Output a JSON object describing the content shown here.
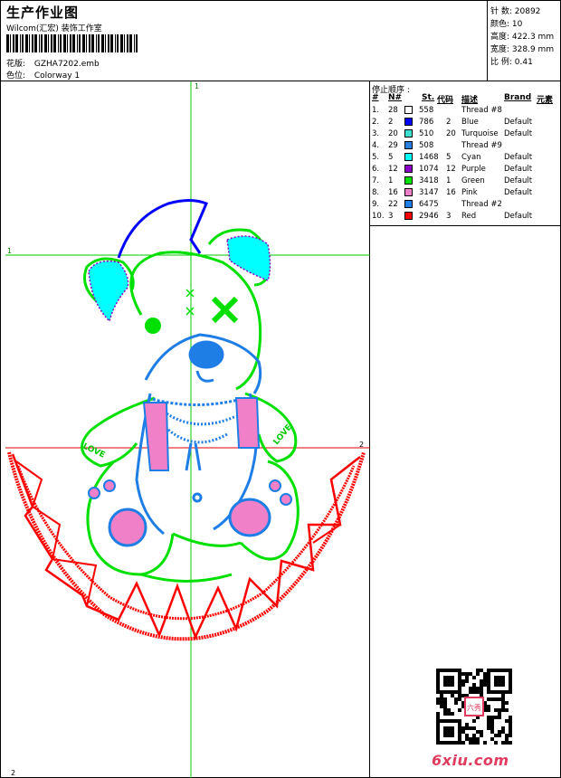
{
  "header": {
    "title": "生产作业图",
    "subtitle": "Wilcom(汇宏) 装饰工作室",
    "file_label": "花版:",
    "file_value": "GZHA7202.emb",
    "colorway_label": "色位:",
    "colorway_value": "Colorway 1"
  },
  "stats": [
    {
      "label": "针 数:",
      "value": "20892"
    },
    {
      "label": "颜色:",
      "value": "10"
    },
    {
      "label": "高度:",
      "value": "422.3 mm"
    },
    {
      "label": "宽度:",
      "value": "328.9 mm"
    },
    {
      "label": "比 例:",
      "value": "0.41"
    }
  ],
  "design": {
    "guide_top_label": "1",
    "guide_left_label": "1",
    "guide_right_label": "2",
    "guide_bottom_label": "2",
    "words": [
      "LOVE",
      "LOVE"
    ],
    "guide_color": "#00c800",
    "red_guide_color": "#e00000"
  },
  "stop_sequence": {
    "title": "停止顺序 :",
    "headers": {
      "num": "#",
      "needle": "N#",
      "st": "St.",
      "code": "代码",
      "desc": "描述",
      "brand": "Brand",
      "element": "元素"
    },
    "rows": [
      {
        "idx": "1.",
        "n": "28",
        "color": "#ffffff",
        "st": "558",
        "code": "",
        "desc": "Thread #8",
        "brand": ""
      },
      {
        "idx": "2.",
        "n": "2",
        "color": "#0000ff",
        "st": "786",
        "code": "2",
        "desc": "Blue",
        "brand": "Default"
      },
      {
        "idx": "3.",
        "n": "20",
        "color": "#40e0d0",
        "st": "510",
        "code": "20",
        "desc": "Turquoise",
        "brand": "Default"
      },
      {
        "idx": "4.",
        "n": "29",
        "color": "#2a7fdc",
        "st": "508",
        "code": "",
        "desc": "Thread #9",
        "brand": ""
      },
      {
        "idx": "5.",
        "n": "5",
        "color": "#00ffff",
        "st": "1468",
        "code": "5",
        "desc": "Cyan",
        "brand": "Default"
      },
      {
        "idx": "6.",
        "n": "12",
        "color": "#8b00c8",
        "st": "1074",
        "code": "12",
        "desc": "Purple",
        "brand": "Default"
      },
      {
        "idx": "7.",
        "n": "1",
        "color": "#00e000",
        "st": "3418",
        "code": "1",
        "desc": "Green",
        "brand": "Default"
      },
      {
        "idx": "8.",
        "n": "16",
        "color": "#f080c8",
        "st": "3147",
        "code": "16",
        "desc": "Pink",
        "brand": "Default"
      },
      {
        "idx": "9.",
        "n": "22",
        "color": "#1e7ee6",
        "st": "6475",
        "code": "",
        "desc": "Thread #2",
        "brand": ""
      },
      {
        "idx": "10.",
        "n": "3",
        "color": "#ff0000",
        "st": "2946",
        "code": "3",
        "desc": "Red",
        "brand": "Default"
      }
    ]
  },
  "footer": {
    "logo": "6xiu.com",
    "stamp": "六秀"
  }
}
